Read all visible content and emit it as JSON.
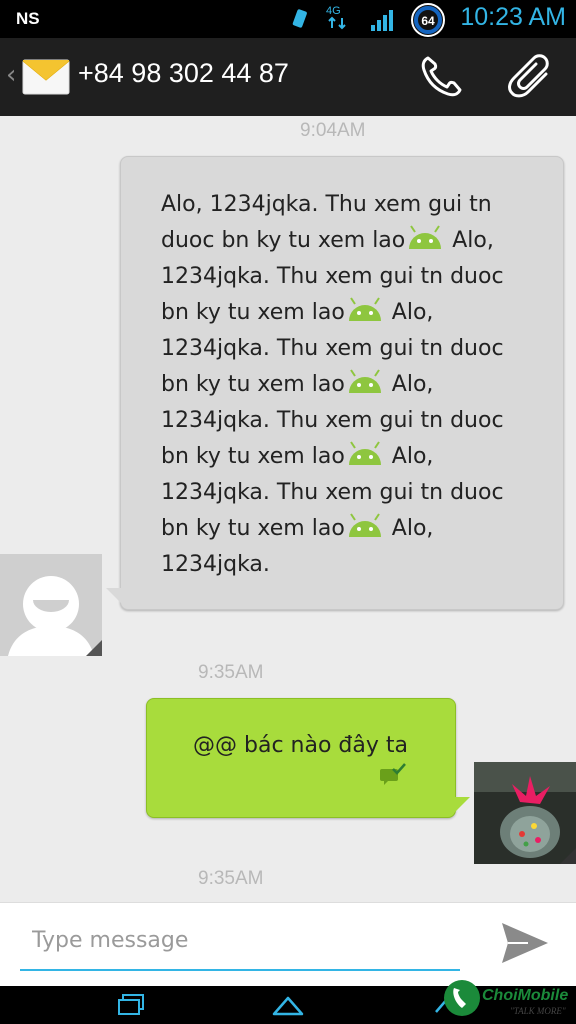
{
  "status_bar": {
    "carrier": "NS",
    "network": "4G",
    "battery_level": "64",
    "time": "10:23 AM",
    "icons": [
      "usb-phone-icon",
      "network-4g-icon",
      "signal-icon",
      "battery-icon"
    ]
  },
  "action_bar": {
    "contact_number": "+84 98 302 44 87",
    "icons": [
      "sms-envelope-icon",
      "phone-icon",
      "paperclip-icon"
    ]
  },
  "conversation": {
    "incoming": {
      "timestamp": "9:04AM",
      "lines": [
        "Alo, 1234jqka. Thu xem gui tn",
        "duoc bn ky tu xem lao",
        "Alo,",
        "1234jqka. Thu xem gui tn duoc",
        "bn ky tu xem lao",
        "Alo,",
        "1234jqka. Thu xem gui tn duoc",
        "bn ky tu xem lao",
        "Alo,",
        "1234jqka. Thu xem gui tn duoc",
        "bn ky tu xem lao",
        "Alo,",
        "1234jqka. Thu xem gui tn duoc",
        "bn ky tu xem lao",
        "Alo,",
        "1234jqka."
      ]
    },
    "outgoing": {
      "timestamp": "9:35AM",
      "text": "@@ bác nào đây ta"
    },
    "pending_timestamp": "9:35AM"
  },
  "composer": {
    "placeholder": "Type message",
    "value": ""
  },
  "watermark": {
    "brand": "ChoiMobile",
    "tagline": "\"TALK MORE\""
  },
  "colors": {
    "accent": "#33b5e5",
    "outgoing_bubble": "#a8dc3c",
    "incoming_bubble": "#d9d9d9",
    "android_green": "#8ec63f"
  }
}
